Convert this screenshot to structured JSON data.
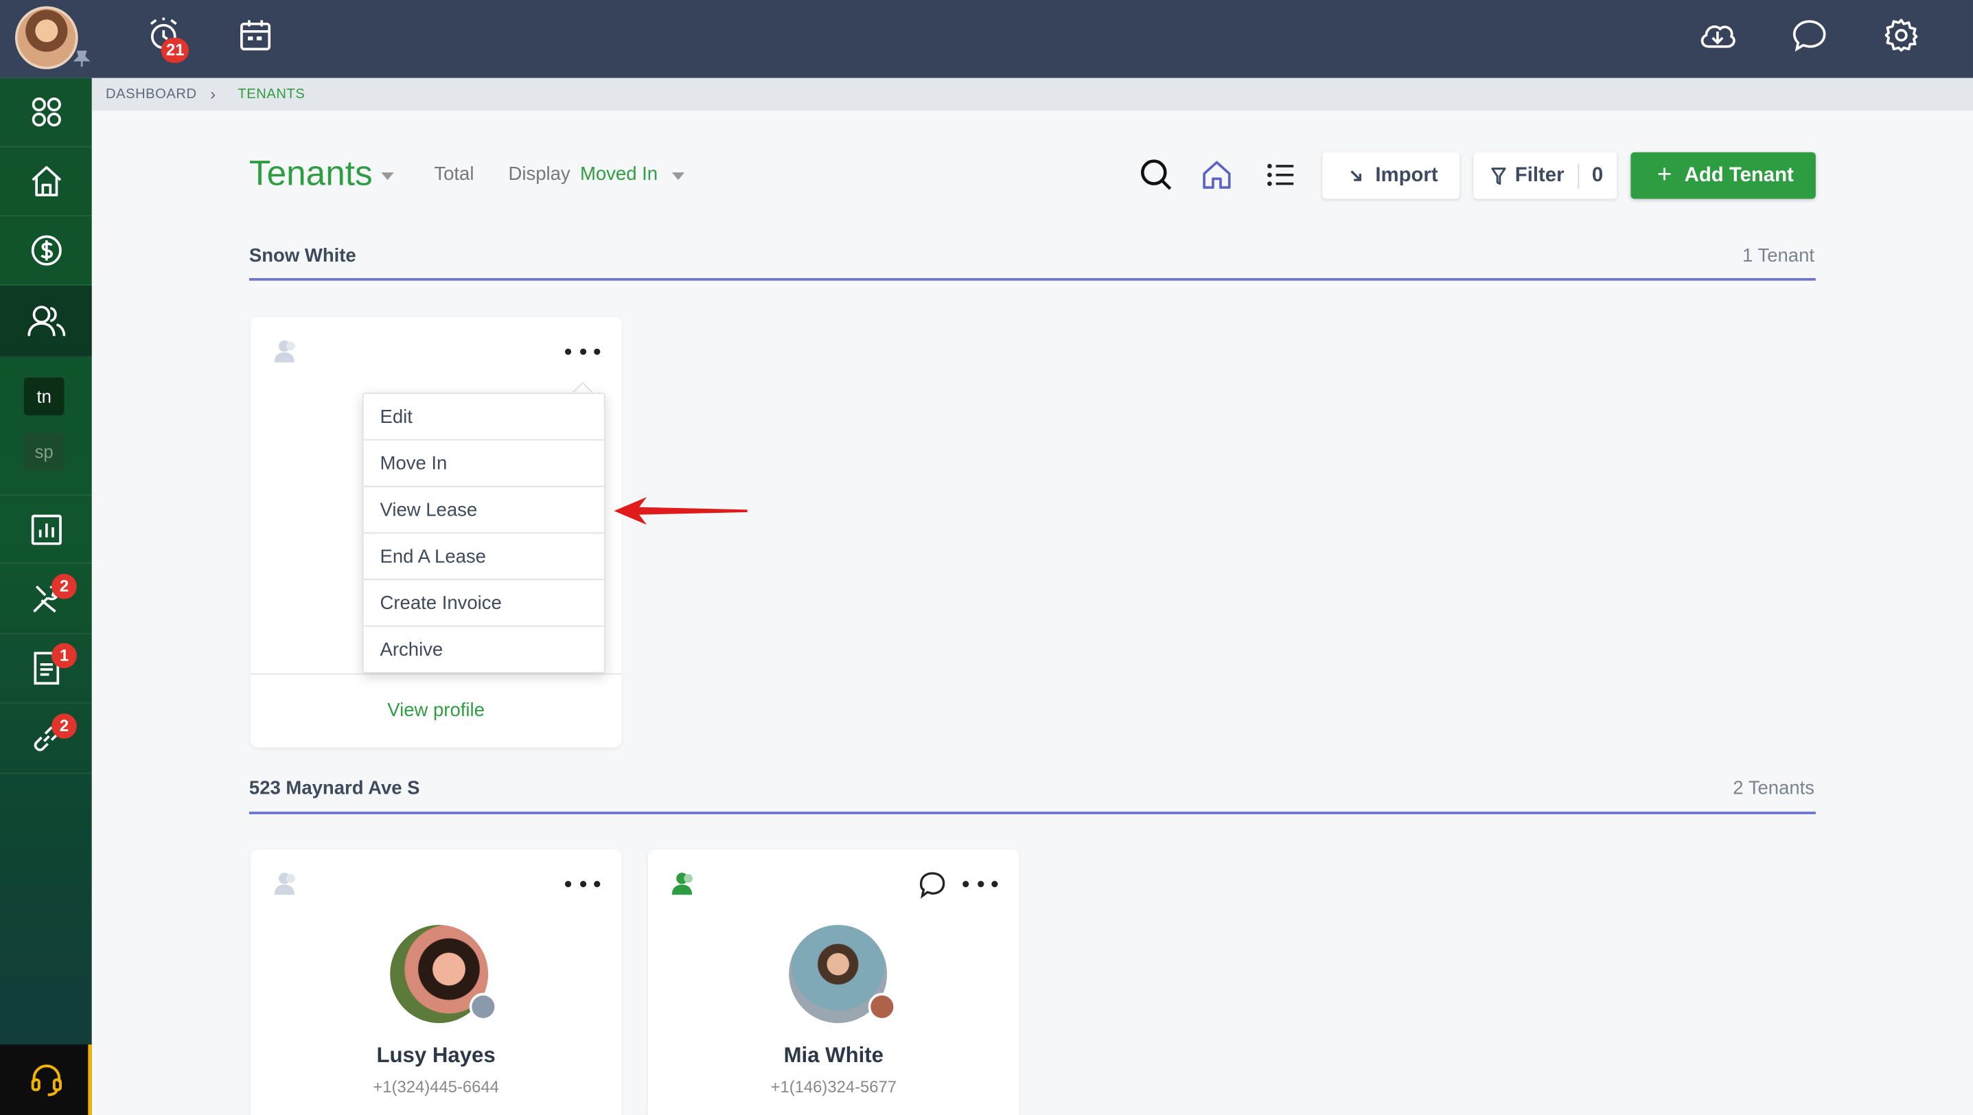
{
  "topbar": {
    "notifications_count": "21",
    "icons": [
      "alarm-icon",
      "calendar-icon",
      "cloud-download-icon",
      "chat-icon",
      "gear-icon"
    ]
  },
  "sidebar": {
    "items": [
      "dashboard-grid-icon",
      "home-icon",
      "dollar-icon",
      "people-icon",
      "reports-icon",
      "tools-icon",
      "document-icon",
      "link-icon"
    ],
    "chips": [
      "tn",
      "sp"
    ],
    "badges": {
      "tools": "2",
      "documents": "1",
      "links": "2"
    }
  },
  "breadcrumb": {
    "items": [
      "DASHBOARD",
      "TENANTS"
    ],
    "separator": "›"
  },
  "header": {
    "title": "Tenants",
    "total_label": "Total",
    "display_label": "Display",
    "display_value": "Moved In",
    "import_label": "Import",
    "filter_label": "Filter",
    "filter_count": "0",
    "add_label": "Add Tenant"
  },
  "groups": [
    {
      "name": "Snow White",
      "count": "1 Tenant",
      "cards": [
        {
          "view_profile": "View profile"
        }
      ]
    },
    {
      "name": "523 Maynard Ave S",
      "count": "2 Tenants",
      "cards": [
        {
          "name": "Lusy Hayes",
          "phone": "+1(324)445-6644"
        },
        {
          "name": "Mia White",
          "phone": "+1(146)324-5677"
        }
      ]
    }
  ],
  "context_menu": {
    "items": [
      "Edit",
      "Move In",
      "View Lease",
      "End A Lease",
      "Create Invoice",
      "Archive"
    ]
  },
  "colors": {
    "topbar": "#36435a",
    "brand_green": "#2e9d41",
    "group_underline": "#6a73d0",
    "badge_red": "#e0342d",
    "annotation_arrow": "#e01b1b"
  }
}
